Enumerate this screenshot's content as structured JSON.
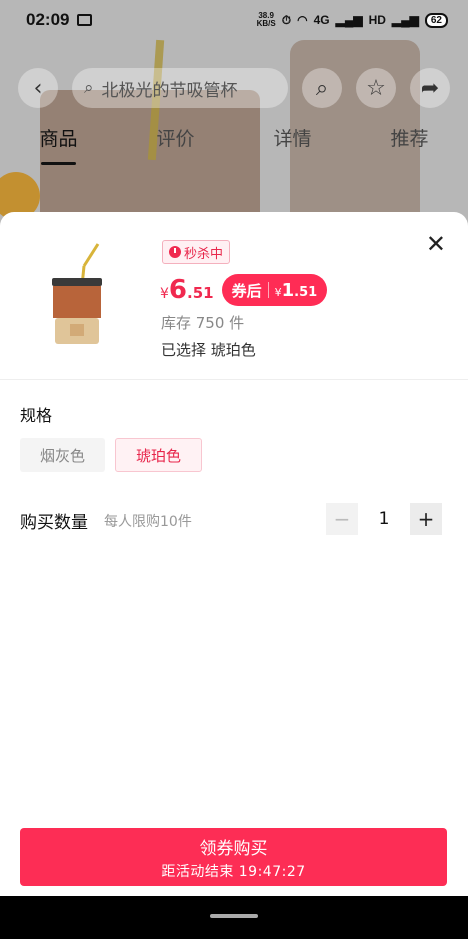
{
  "status_bar": {
    "time": "02:09",
    "net_speed_value": "38.9",
    "net_speed_unit": "KB/S",
    "network": "4G",
    "hd": "HD",
    "battery": "62"
  },
  "search": {
    "placeholder": "北极光的节吸管杯"
  },
  "tabs": [
    {
      "label": "商品",
      "active": true
    },
    {
      "label": "评价",
      "active": false
    },
    {
      "label": "详情",
      "active": false
    },
    {
      "label": "推荐",
      "active": false
    }
  ],
  "sheet": {
    "badge": "秒杀中",
    "price": {
      "currency": "¥",
      "integer": "6",
      "decimal": ".51"
    },
    "coupon": {
      "label": "券后",
      "currency": "¥",
      "integer": "1",
      "decimal": ".51"
    },
    "stock": "库存 750 件",
    "selected": "已选择  琥珀色",
    "spec_title": "规格",
    "options": [
      {
        "label": "烟灰色",
        "selected": false
      },
      {
        "label": "琥珀色",
        "selected": true
      }
    ],
    "quantity": {
      "label": "购买数量",
      "limit": "每人限购10件",
      "value": "1",
      "minus": "−",
      "plus": "+"
    },
    "buy_button": {
      "label": "领券购买",
      "countdown": "距活动结束  19:47:27"
    }
  },
  "colors": {
    "accent": "#fd2d55",
    "price": "#f0294f"
  }
}
